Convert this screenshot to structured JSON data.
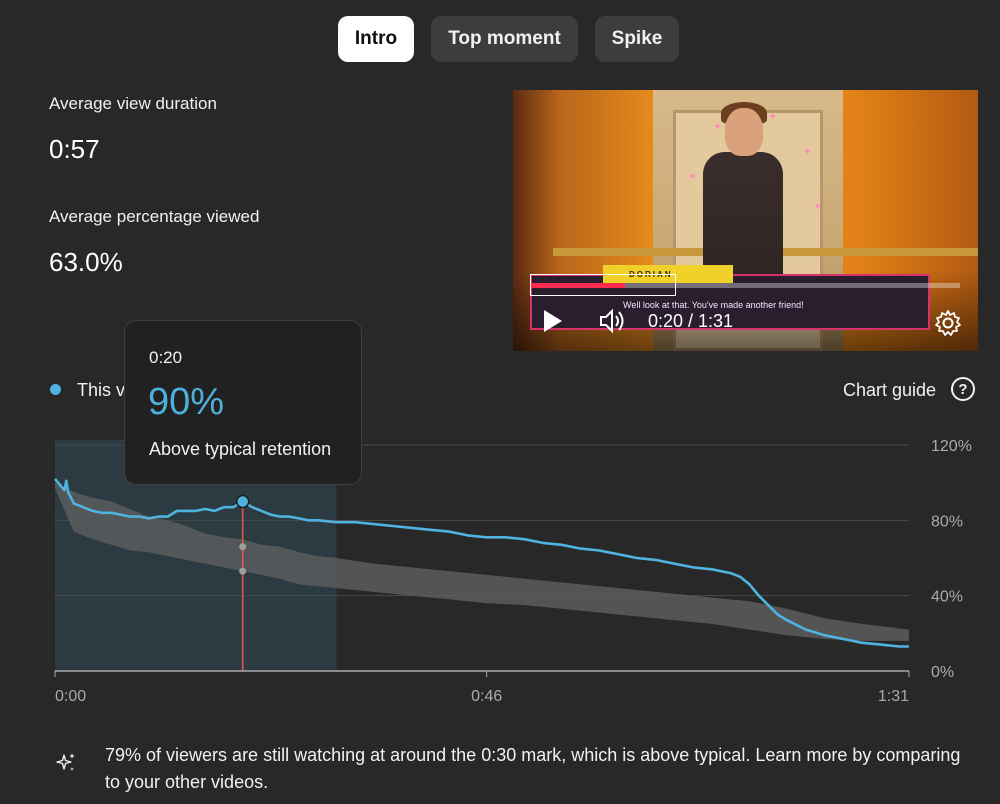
{
  "tabs": [
    {
      "label": "Intro",
      "active": true
    },
    {
      "label": "Top moment",
      "active": false
    },
    {
      "label": "Spike",
      "active": false
    }
  ],
  "stats": {
    "avg_view_duration": {
      "label": "Average view duration",
      "value": "0:57"
    },
    "avg_percentage_viewed": {
      "label": "Average percentage viewed",
      "value": "63.0%"
    }
  },
  "video": {
    "time_display": "0:20 / 1:31",
    "played_fraction": 0.22,
    "dialog_name": "DORIAN",
    "dialog_text": "Well look at that. You've made another friend!",
    "icons": {
      "play": "play-icon",
      "volume": "volume-icon",
      "settings": "gear-icon"
    }
  },
  "tooltip": {
    "time": "0:20",
    "value": "90%",
    "description": "Above typical retention"
  },
  "legend": {
    "series_label": "This v",
    "color": "#4fb3e0"
  },
  "chart_guide": {
    "label": "Chart guide",
    "icon": "help-icon"
  },
  "chart_data": {
    "type": "line",
    "x_tick_labels": [
      "0:00",
      "0:46",
      "1:31"
    ],
    "y_tick_labels": [
      "120%",
      "80%",
      "40%",
      "0%"
    ],
    "ylim": [
      0,
      120
    ],
    "xlim": [
      0,
      91
    ],
    "grid": true,
    "highlight_range": [
      0,
      30
    ],
    "marker_x": 20,
    "series": [
      {
        "color": "#4fb3e0",
        "x": [
          0,
          1,
          1.2,
          1.4,
          2,
          3,
          4,
          5,
          6,
          7,
          8,
          9,
          10,
          11,
          12,
          13,
          14,
          15,
          16,
          17,
          18,
          19,
          20,
          21,
          22,
          23,
          24,
          25,
          26,
          27,
          28,
          30,
          32,
          34,
          36,
          38,
          40,
          42,
          44,
          46,
          48,
          50,
          52,
          54,
          56,
          58,
          60,
          62,
          64,
          66,
          68,
          70,
          72,
          73,
          74,
          75,
          76,
          77,
          78,
          80,
          82,
          84,
          86,
          88,
          90,
          91
        ],
        "values": [
          102,
          96,
          101,
          95,
          89,
          87,
          85,
          84,
          84,
          83,
          82,
          82,
          81,
          82,
          82,
          85,
          85,
          85,
          86,
          85,
          87,
          87,
          90,
          87,
          85,
          83,
          82,
          82,
          81,
          80,
          80,
          79,
          79,
          78,
          77,
          76,
          75,
          74,
          72,
          71,
          71,
          70,
          68,
          67,
          65,
          64,
          62,
          60,
          59,
          57,
          55,
          54,
          52,
          50,
          46,
          40,
          35,
          30,
          27,
          22,
          19,
          17,
          15,
          14,
          13,
          13
        ]
      }
    ],
    "typical_band": {
      "color": "#5f5f5f",
      "x": [
        0,
        2,
        4,
        6,
        8,
        10,
        12,
        14,
        16,
        18,
        20,
        22,
        24,
        26,
        28,
        30,
        34,
        38,
        42,
        46,
        50,
        54,
        58,
        62,
        66,
        70,
        74,
        78,
        82,
        86,
        91
      ],
      "upper": [
        100,
        95,
        92,
        90,
        86,
        82,
        80,
        77,
        73,
        71,
        70,
        67,
        66,
        63,
        61,
        60,
        57,
        55,
        53,
        51,
        49,
        47,
        45,
        43,
        41,
        39,
        37,
        33,
        28,
        25,
        22
      ],
      "lower": [
        97,
        74,
        70,
        67,
        64,
        63,
        61,
        59,
        57,
        55,
        53,
        51,
        49,
        46,
        45,
        44,
        42,
        40,
        38,
        36,
        35,
        33,
        31,
        29,
        27,
        25,
        22,
        19,
        17,
        16,
        16
      ]
    },
    "marker_points": [
      {
        "x": 20,
        "value": 90,
        "color": "#4fb3e0"
      },
      {
        "x": 20,
        "value": 66,
        "color": "#9e9e9e"
      },
      {
        "x": 20,
        "value": 53,
        "color": "#9e9e9e"
      }
    ]
  },
  "insight": {
    "icon": "sparkle-icon",
    "text": "79% of viewers are still watching at around the 0:30 mark, which is above typical. Learn more by comparing to your other videos."
  }
}
